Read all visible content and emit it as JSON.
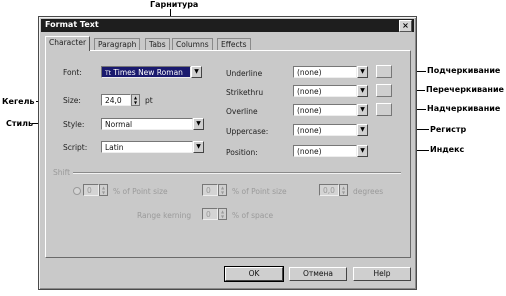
{
  "window": {
    "title": "Format Text",
    "close_glyph": "×"
  },
  "tabs": [
    {
      "label": "Character",
      "active": true
    },
    {
      "label": "Paragraph",
      "active": false
    },
    {
      "label": "Tabs",
      "active": false
    },
    {
      "label": "Columns",
      "active": false
    },
    {
      "label": "Effects",
      "active": false
    }
  ],
  "left": {
    "font_label": "Font:",
    "font_value": "Times New Roman",
    "font_type_glyph": "Tt",
    "size_label": "Size:",
    "size_value": "24,0",
    "size_unit": "pt",
    "style_label": "Style:",
    "style_value": "Normal",
    "script_label": "Script:",
    "script_value": "Latin"
  },
  "right": {
    "underline_label": "Underline",
    "underline_value": "(none)",
    "strikethru_label": "Strikethru",
    "strikethru_value": "(none)",
    "overline_label": "Overline",
    "overline_value": "(none)",
    "uppercase_label": "Uppercase:",
    "uppercase_value": "(none)",
    "position_label": "Position:",
    "position_value": "(none)"
  },
  "shift": {
    "section_label": "Shift",
    "horizontal_value": "0",
    "horizontal_label": "% of Point size",
    "vertical_value": "0",
    "vertical_label": "% of Point size",
    "rotation_value": "0,0",
    "rotation_label": "degrees",
    "range_label": "Range kerning",
    "range_value": "0",
    "range_suffix": "% of space"
  },
  "buttons": {
    "ok": "OK",
    "cancel": "Отмена",
    "help": "Help"
  },
  "annotations": {
    "typeface": "Гарнитура",
    "size": "Кегель",
    "style": "Стиль",
    "underline": "Подчеркивание",
    "strikethrough": "Перечеркивание",
    "overline": "Надчеркивание",
    "case": "Регистр",
    "index": "Индекс"
  }
}
